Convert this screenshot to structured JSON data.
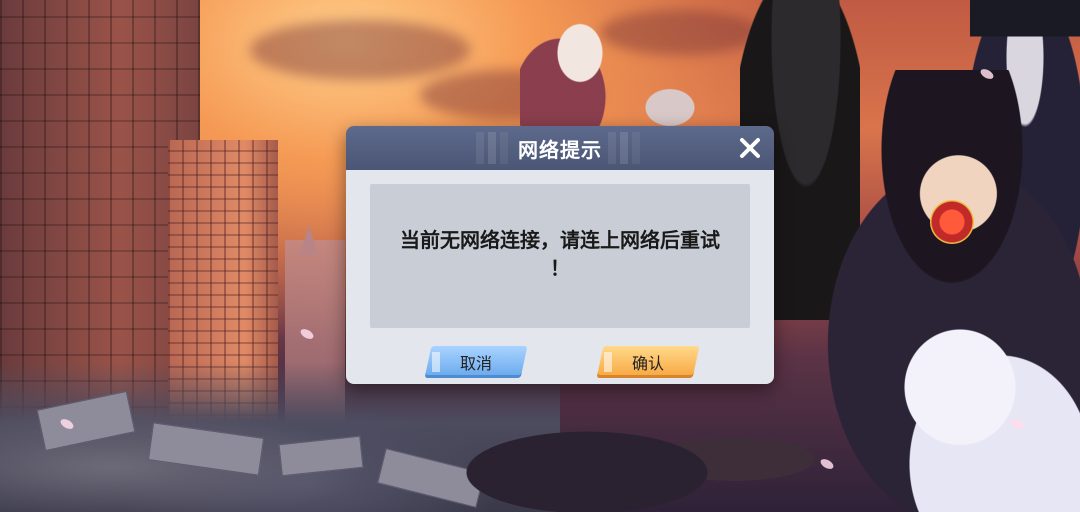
{
  "dialog": {
    "title": "网络提示",
    "message_line1": "当前无网络连接，请连上网络后重试",
    "message_line2": "！",
    "cancel_label": "取消",
    "confirm_label": "确认",
    "close_icon": "close-icon"
  },
  "colors": {
    "header": "#4b5675",
    "body": "#e3e6ec",
    "message_panel": "#c9cdd6",
    "cancel_button": "#68a8ec",
    "confirm_button": "#f7a640"
  }
}
